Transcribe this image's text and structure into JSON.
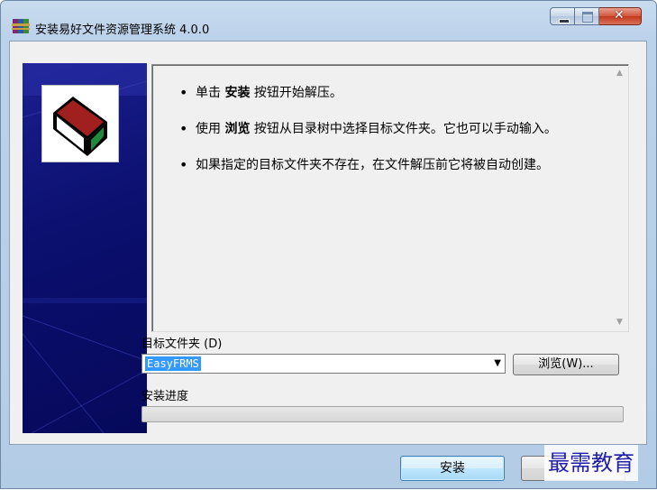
{
  "window": {
    "title": "安装易好文件资源管理系统 4.0.0"
  },
  "info": {
    "items": [
      {
        "pre": "单击 ",
        "bold": "安装",
        "post": " 按钮开始解压。"
      },
      {
        "pre": "使用 ",
        "bold": "浏览",
        "post": " 按钮从目录树中选择目标文件夹。它也可以手动输入。"
      },
      {
        "pre": "",
        "bold": "",
        "post": "如果指定的目标文件夹不存在，在文件解压前它将被自动创建。"
      }
    ]
  },
  "destination": {
    "label": "目标文件夹 (D)",
    "value": "EasyFRMS",
    "browse_label": "浏览(W)..."
  },
  "progress": {
    "label": "安装进度",
    "value_fraction": 0
  },
  "buttons": {
    "install_label": "安装",
    "cancel_label": ""
  },
  "watermark": {
    "text": "最需教育"
  },
  "colors": {
    "banner": "#0b0f6e",
    "selection": "#3399ff",
    "watermark": "#1e1ea8"
  }
}
